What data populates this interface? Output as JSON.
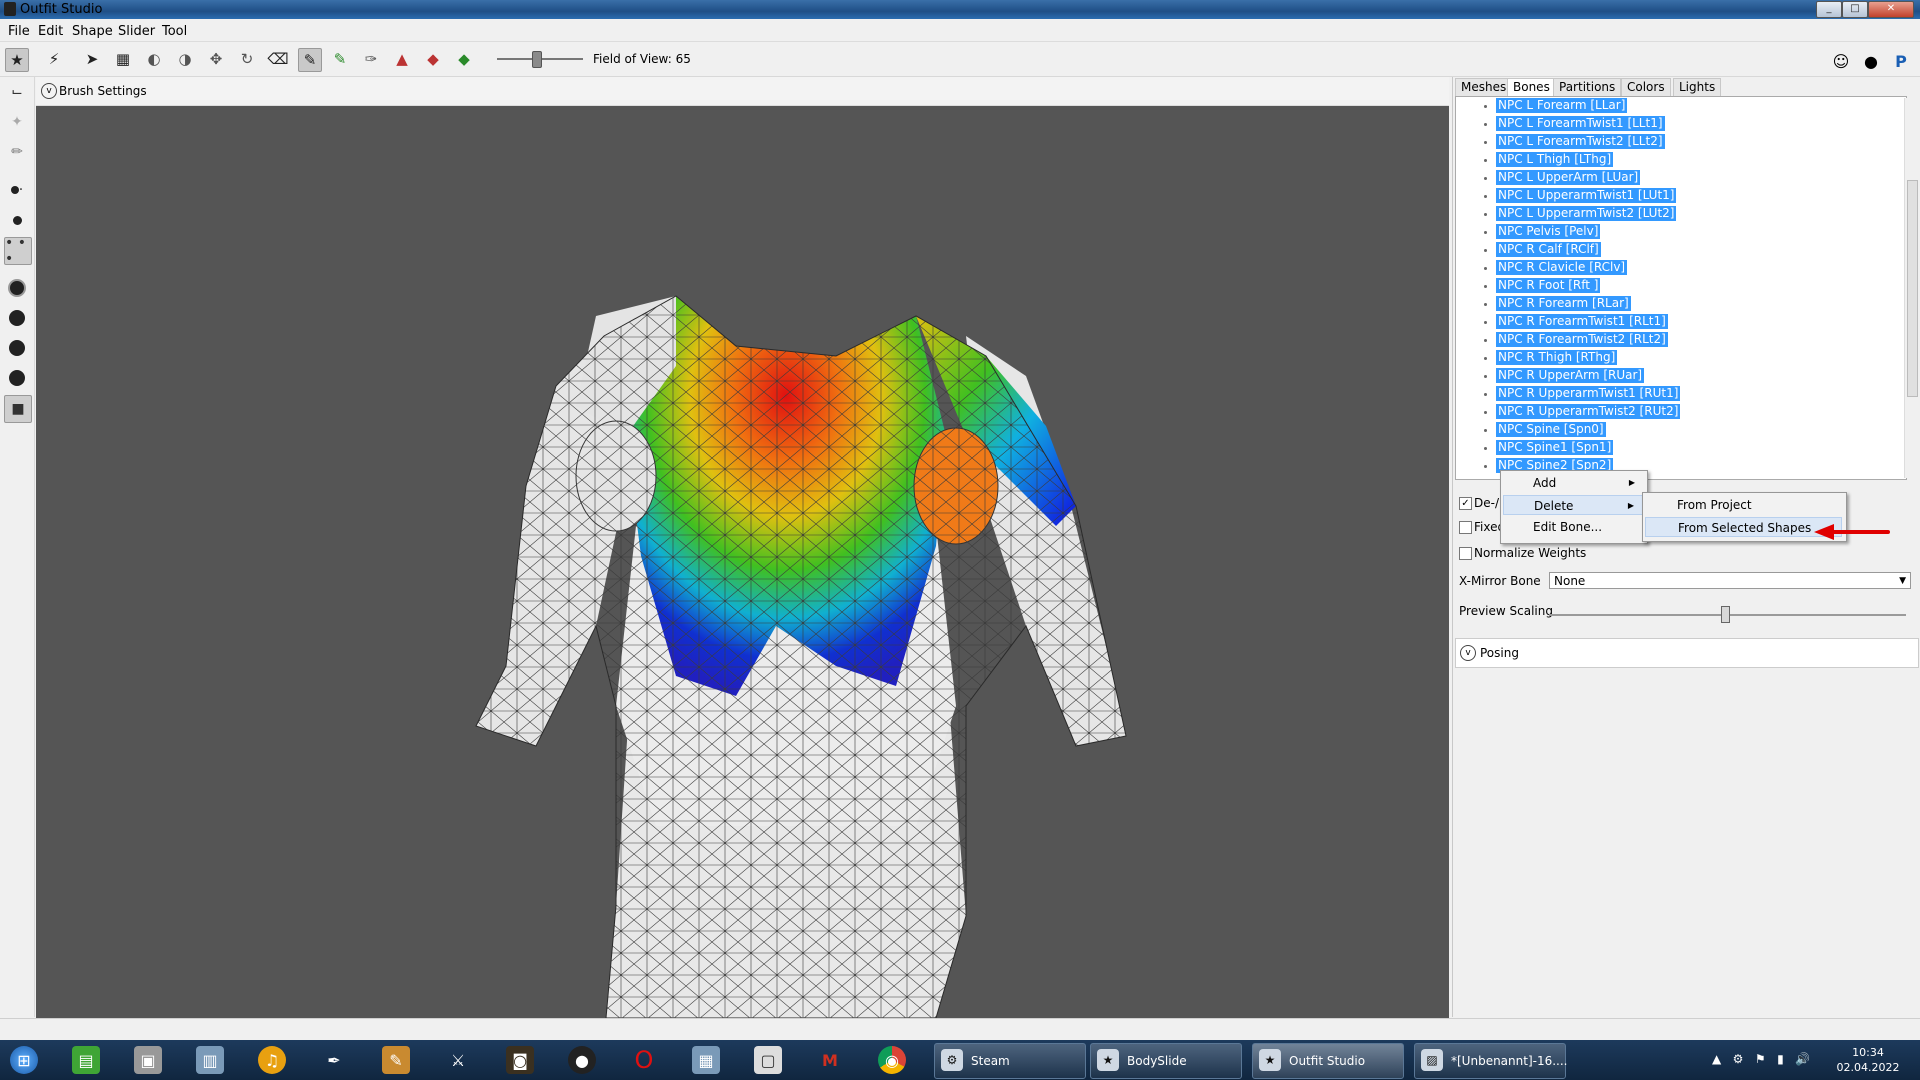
{
  "window": {
    "title": "Outfit Studio",
    "min": "_",
    "max": "□",
    "close": "✕"
  },
  "menu": [
    "File",
    "Edit",
    "Shape",
    "Slider",
    "Tool"
  ],
  "toolbar": {
    "fov_label": "Field of View: 65"
  },
  "viewport": {
    "brush_settings": "Brush Settings"
  },
  "tabs": [
    "Meshes",
    "Bones",
    "Partitions",
    "Colors",
    "Lights"
  ],
  "active_tab": "Bones",
  "bones": [
    "NPC L Forearm [LLar]",
    "NPC L ForearmTwist1 [LLt1]",
    "NPC L ForearmTwist2 [LLt2]",
    "NPC L Thigh [LThg]",
    "NPC L UpperArm [LUar]",
    "NPC L UpperarmTwist1 [LUt1]",
    "NPC L UpperarmTwist2 [LUt2]",
    "NPC Pelvis [Pelv]",
    "NPC R Calf [RClf]",
    "NPC R Clavicle [RClv]",
    "NPC R Foot [Rft ]",
    "NPC R Forearm [RLar]",
    "NPC R ForearmTwist1 [RLt1]",
    "NPC R ForearmTwist2 [RLt2]",
    "NPC R Thigh [RThg]",
    "NPC R UpperArm [RUar]",
    "NPC R UpperarmTwist1 [RUt1]",
    "NPC R UpperarmTwist2 [RUt2]",
    "NPC Spine [Spn0]",
    "NPC Spine1 [Spn1]",
    "NPC Spine2 [Spn2]"
  ],
  "bone_options": {
    "deselect_label": "De-/",
    "fixed_label": "Fixed",
    "normalize_label": "Normalize Weights",
    "xmirror_label": "X-Mirror Bone",
    "xmirror_value": "None",
    "preview_scaling_label": "Preview Scaling",
    "preview_scaling_fraction": 0.49,
    "posing_label": "Posing"
  },
  "context_menu": {
    "items": [
      "Add",
      "Delete",
      "Edit Bone..."
    ],
    "highlighted": "Delete"
  },
  "submenu": {
    "items": [
      "From Project",
      "From Selected Shapes"
    ],
    "highlighted": "From Selected Shapes"
  },
  "taskbar": {
    "tasks": [
      "Steam",
      "BodySlide",
      "Outfit Studio",
      "*[Unbenannt]-16...."
    ],
    "active_task": "Outfit Studio",
    "time": "10:34",
    "date": "02.04.2022"
  },
  "colors": {
    "selection": "#3399ff",
    "viewport_bg": "#555555",
    "annotation_arrow": "#e00000"
  }
}
